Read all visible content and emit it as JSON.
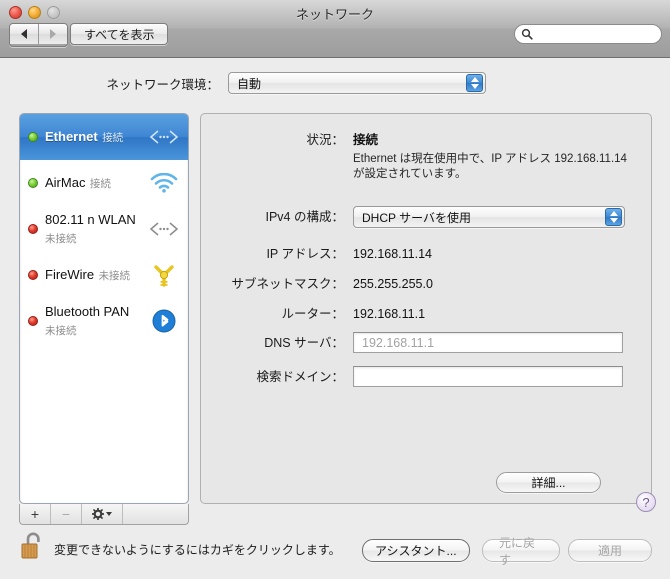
{
  "window": {
    "title": "ネットワーク",
    "traffic_lights": [
      "close",
      "minimize",
      "zoom"
    ]
  },
  "toolbar": {
    "back_icon": "back-arrow-icon",
    "forward_icon": "forward-arrow-icon",
    "show_all_label": "すべてを表示",
    "search_placeholder": "",
    "search_value": "",
    "search_icon": "search-icon"
  },
  "location": {
    "label": "ネットワーク環境：",
    "value": "自動"
  },
  "sidebar": {
    "items": [
      {
        "name": "Ethernet",
        "status": "接続",
        "dot": "green",
        "icon": "ethernet-icon",
        "selected": true
      },
      {
        "name": "AirMac",
        "status": "接続",
        "dot": "green",
        "icon": "wifi-icon",
        "selected": false
      },
      {
        "name": "802.11 n WLAN",
        "status": "未接続",
        "dot": "red",
        "icon": "ethernet-icon",
        "selected": false
      },
      {
        "name": "FireWire",
        "status": "未接続",
        "dot": "red",
        "icon": "firewire-icon",
        "selected": false
      },
      {
        "name": "Bluetooth PAN",
        "status": "未接続",
        "dot": "red",
        "icon": "bluetooth-icon",
        "selected": false
      }
    ],
    "add_label": "+",
    "remove_label": "−",
    "action_icon": "gear-icon"
  },
  "detail": {
    "status_label": "状況：",
    "status_value": "接続",
    "status_description": "Ethernet は現在使用中で、IP アドレス 192.168.11.14 が設定されています。",
    "ipv4_label": "IPv4 の構成：",
    "ipv4_value": "DHCP サーバを使用",
    "ip_label": "IP アドレス：",
    "ip_value": "192.168.11.14",
    "subnet_label": "サブネットマスク：",
    "subnet_value": "255.255.255.0",
    "router_label": "ルーター：",
    "router_value": "192.168.11.1",
    "dns_label": "DNS サーバ：",
    "dns_value": "",
    "dns_placeholder": "192.168.11.1",
    "domains_label": "検索ドメイン：",
    "domains_value": "",
    "domains_placeholder": "",
    "advanced_label": "詳細...",
    "help_label": "?"
  },
  "bottom": {
    "lock_icon": "unlocked-padlock-icon",
    "lock_text": "変更できないようにするにはカギをクリックします。",
    "assistant_label": "アシスタント...",
    "revert_label": "元に戻す",
    "apply_label": "適用"
  },
  "colors": {
    "selection_blue": "#3e86d3",
    "connected_green": "#7fd13c",
    "disconnected_red": "#e33c2c",
    "window_bg": "#ececec",
    "panel_bg": "#e7e7e7"
  }
}
